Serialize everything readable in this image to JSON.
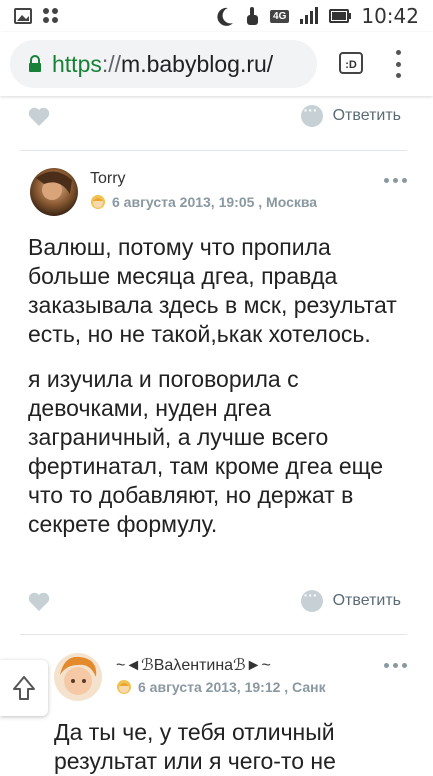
{
  "statusbar": {
    "network": "4G",
    "time": "10:42"
  },
  "browser": {
    "url_scheme": "https",
    "url_sep": "://",
    "url_host": "m.babyblog.ru/",
    "tabs_label": ":D"
  },
  "actions": {
    "reply_label": "Ответить"
  },
  "comments": [
    {
      "author": "Torry",
      "meta": "6 августа 2013, 19:05 , Москва",
      "paragraphs": [
        "Валюш, потому что пропила больше месяца дгеа, правда заказывала здесь в мск, результат есть, но не такой,ькак хотелось.",
        "я изучила и поговорила с девочками, нуден дгеа заграничный, а лучше всего фертинатал, там кроме дгеа еще что то добавляют, но держат в секрете формулу."
      ]
    },
    {
      "author": "~◄ℬВаλентинаℬ►~",
      "meta": "6 августа 2013, 19:12 , Санк",
      "paragraphs": [
        "Да ты че, у тебя отличный результат или я чего-то не"
      ]
    }
  ],
  "colors": {
    "accent": "#188038",
    "muted": "#8a98a0",
    "heart": "#c6d0d5"
  }
}
